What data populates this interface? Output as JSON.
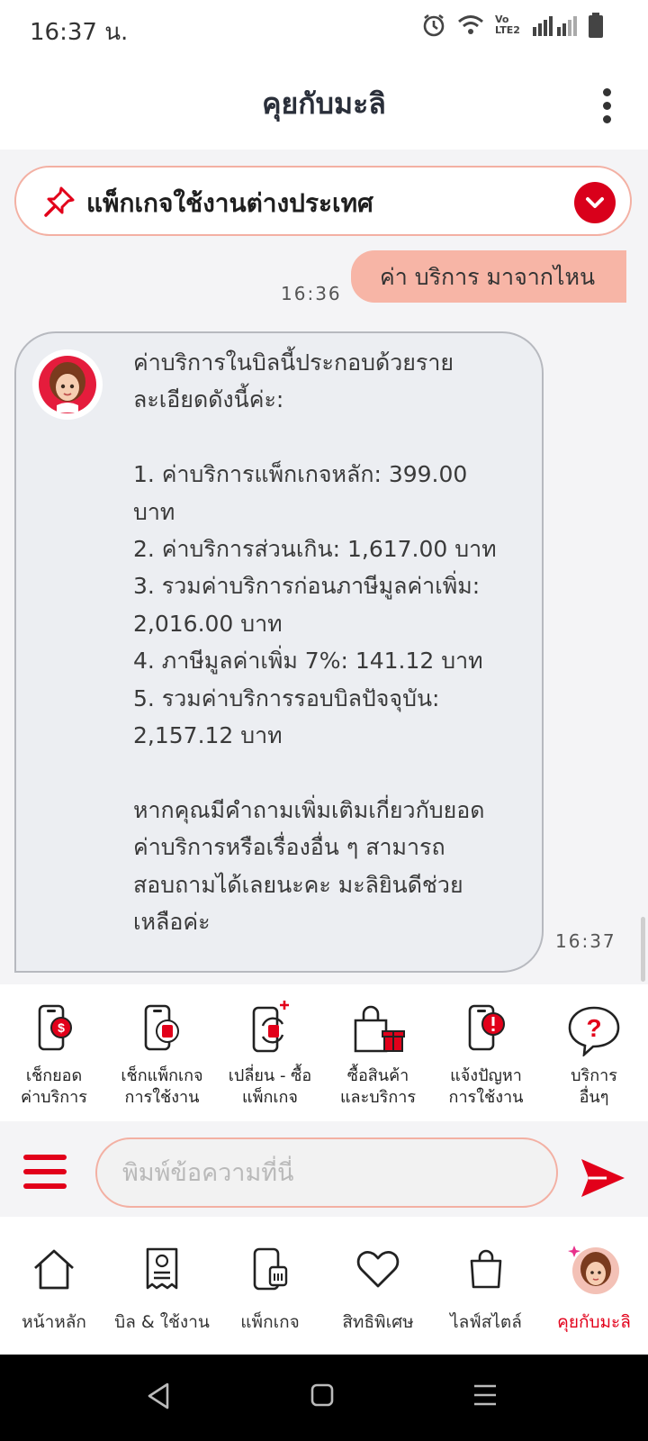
{
  "status": {
    "time": "16:37 น.",
    "network_label": "Vo LTE2"
  },
  "header": {
    "title": "คุยกับมะลิ"
  },
  "pinned": {
    "text": "แพ็กเกจใช้งานต่างประเทศ"
  },
  "messages": {
    "user": {
      "text": "ค่า บริการ มาจากไหน",
      "time": "16:36"
    },
    "bot": {
      "text": "ค่าบริการในบิลนี้ประกอบด้วยราย\nละเอียดดังนี้ค่ะ:\n\n1. ค่าบริการแพ็กเกจหลัก: 399.00\nบาท\n2. ค่าบริการส่วนเกิน: 1,617.00 บาท\n3. รวมค่าบริการก่อนภาษีมูลค่าเพิ่ม:\n2,016.00 บาท\n4. ภาษีมูลค่าเพิ่ม 7%: 141.12 บาท\n5. รวมค่าบริการรอบบิลปัจจุบัน:\n2,157.12 บาท\n\nหากคุณมีคำถามเพิ่มเติมเกี่ยวกับยอด\nค่าบริการหรือเรื่องอื่น ๆ สามารถ\nสอบถามได้เลยนะคะ มะลิยินดีช่วย\nเหลือค่ะ",
      "time": "16:37"
    }
  },
  "quick_actions": [
    {
      "label": "เช็กยอด\nค่าบริการ",
      "icon": "phone-bill-icon"
    },
    {
      "label": "เช็กแพ็กเกจ\nการใช้งาน",
      "icon": "phone-sim-icon"
    },
    {
      "label": "เปลี่ยน - ซื้อ\nแพ็กเกจ",
      "icon": "phone-swap-icon"
    },
    {
      "label": "ซื้อสินค้า\nและบริการ",
      "icon": "shopping-bag-gift-icon"
    },
    {
      "label": "แจ้งปัญหา\nการใช้งาน",
      "icon": "phone-alert-icon"
    },
    {
      "label": "บริการ\nอื่นๆ",
      "icon": "question-bubble-icon"
    }
  ],
  "input": {
    "placeholder": "พิมพ์ข้อความที่นี่"
  },
  "tabs": [
    {
      "label": "หน้าหลัก",
      "icon": "home-icon"
    },
    {
      "label": "บิล & ใช้งาน",
      "icon": "bill-icon"
    },
    {
      "label": "แพ็กเกจ",
      "icon": "package-icon"
    },
    {
      "label": "สิทธิพิเศษ",
      "icon": "heart-icon"
    },
    {
      "label": "ไลฟ์สไตล์",
      "icon": "shopping-bag-icon"
    },
    {
      "label": "คุยกับมะลิ",
      "icon": "mali-avatar-icon",
      "active": true
    }
  ],
  "colors": {
    "brand_red": "#e2001a",
    "bubble_user": "#f7b5a6",
    "bubble_bot": "#eceef2"
  }
}
